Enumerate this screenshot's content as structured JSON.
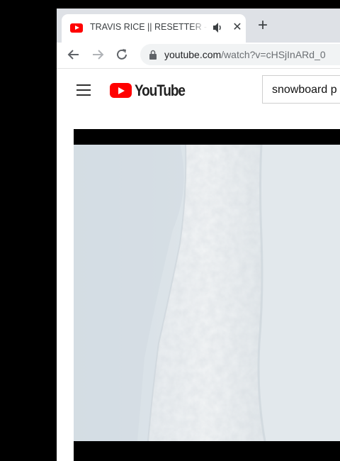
{
  "browser": {
    "tab": {
      "title": "TRAVIS RICE || RESETTER - YouTube",
      "favicon": "youtube-favicon",
      "audio_icon": "speaker-icon",
      "close_icon": "close-icon"
    },
    "new_tab_icon": "plus-icon",
    "nav": {
      "back_icon": "arrow-left-icon",
      "forward_icon": "arrow-right-icon",
      "reload_icon": "reload-icon"
    },
    "address": {
      "host": "youtube.com",
      "path": "/watch?v=cHSjInARd_0",
      "lock_icon": "lock-icon"
    }
  },
  "youtube": {
    "menu_icon": "hamburger-icon",
    "logo_text": "YouTube",
    "search_value": "snowboard p"
  },
  "video": {
    "content": "snowy-mountain-aerial"
  },
  "colors": {
    "brand_red": "#ff0000",
    "tabstrip": "#dee1e6",
    "omnibox": "#f1f3f4"
  }
}
